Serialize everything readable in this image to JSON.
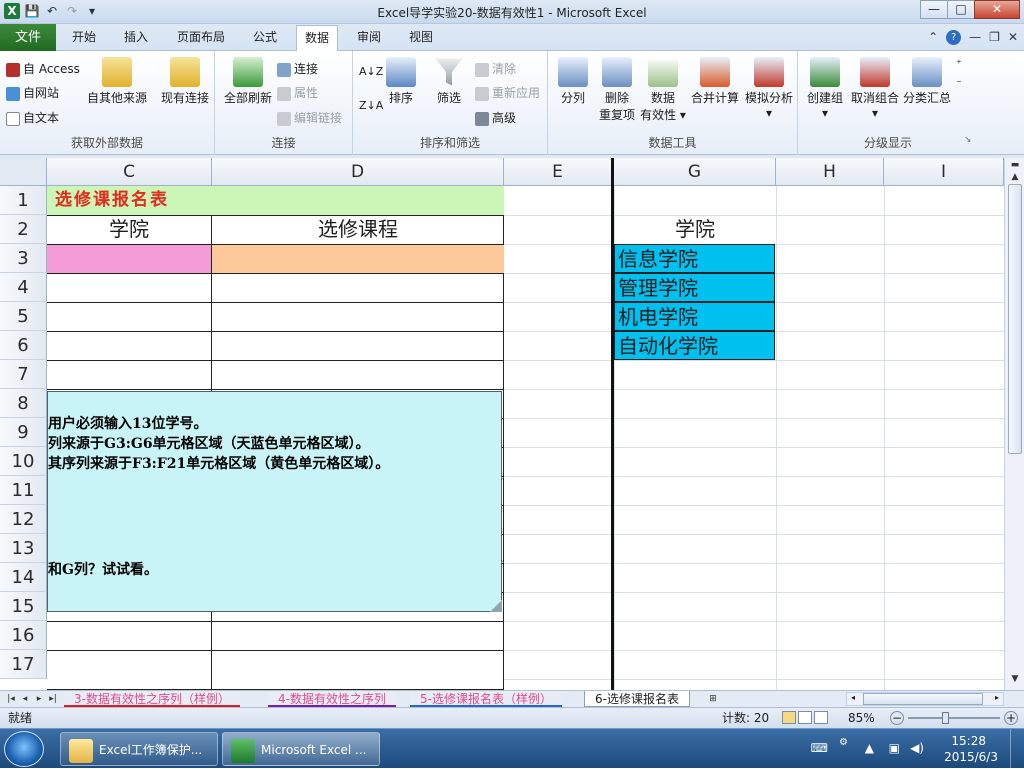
{
  "window": {
    "title": "Excel导学实验20-数据有效性1 - Microsoft Excel",
    "buttons": {
      "minimize": "—",
      "maximize": "□",
      "close": "✕"
    }
  },
  "quick_access": {
    "save_icon": "save-icon",
    "undo_icon": "undo-icon",
    "redo_icon": "redo-icon",
    "customize_icon": "dropdown-icon"
  },
  "ribbon_tabs": {
    "file": "文件",
    "items": [
      "开始",
      "插入",
      "页面布局",
      "公式",
      "数据",
      "审阅",
      "视图"
    ],
    "active": "数据"
  },
  "ribbon": {
    "group_external": {
      "label": "获取外部数据",
      "access": "自 Access",
      "web": "自网站",
      "text": "自文本",
      "other": "自其他来源",
      "existing": "现有连接"
    },
    "group_connections": {
      "label": "连接",
      "refresh_all": "全部刷新",
      "connections": "连接",
      "properties": "属性",
      "edit_links": "编辑链接"
    },
    "group_sort": {
      "label": "排序和筛选",
      "sort": "排序",
      "filter": "筛选",
      "clear": "清除",
      "reapply": "重新应用",
      "advanced": "高级",
      "az": "A↓Z",
      "za": "Z↓A"
    },
    "group_tools": {
      "label": "数据工具",
      "text_to_columns": "分列",
      "remove_dup_1": "删除",
      "remove_dup_2": "重复项",
      "validation_1": "数据",
      "validation_2": "有效性",
      "consolidate": "合并计算",
      "what_if": "模拟分析"
    },
    "group_outline": {
      "label": "分级显示",
      "group": "创建组",
      "ungroup": "取消组合",
      "subtotal": "分类汇总"
    }
  },
  "grid": {
    "columns": [
      "C",
      "D",
      "E",
      "G",
      "H",
      "I"
    ],
    "rows": [
      "1",
      "2",
      "3",
      "4",
      "5",
      "6",
      "7",
      "8",
      "9",
      "10",
      "11",
      "12",
      "13",
      "14",
      "15",
      "16",
      "17"
    ],
    "cells": {
      "c1": "选修课报名表",
      "c2": "学院",
      "d2": "选修课程",
      "g2": "学院",
      "g3": "信息学院",
      "g4": "管理学院",
      "g5": "机电学院",
      "g6": "自动化学院"
    },
    "colors": {
      "title_fill": "#ccf5b8",
      "title_text": "#e8291c",
      "pink_fill": "#f29bd6",
      "orange_fill": "#fcc99b",
      "cyan_fill": "#00c0f0",
      "comment_fill": "#c9f4f7"
    },
    "comment": {
      "line1": "用户必须输入13位学号。",
      "line2": "列来源于G3:G6单元格区域（天蓝色单元格区域）。",
      "line3": "其序列来源于F3:F21单元格区域（黄色单元格区域）。",
      "line4": "和G列？试试看。"
    }
  },
  "sheet_tabs": [
    {
      "label": "3-数据有效性之序列（样例）"
    },
    {
      "label": "4-数据有效性之序列"
    },
    {
      "label": "5-选修课报名表（样例）"
    },
    {
      "label": "6-选修课报名表"
    }
  ],
  "status": {
    "ready": "就绪",
    "count": "计数: 20",
    "zoom": "85%"
  },
  "taskbar": {
    "item1": "Excel工作簿保护...",
    "item2": "Microsoft Excel ...",
    "time": "15:28",
    "date": "2015/6/3"
  }
}
